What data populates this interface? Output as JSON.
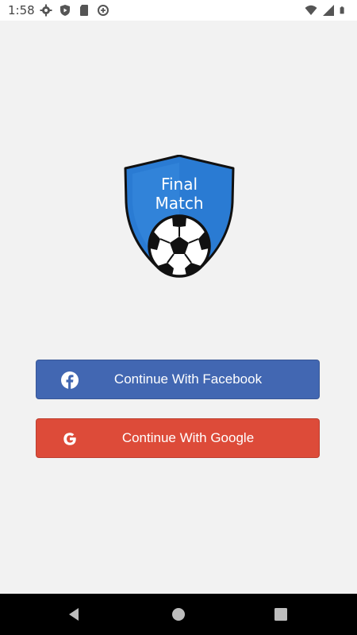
{
  "status_bar": {
    "time": "1:58"
  },
  "logo": {
    "line1": "Final",
    "line2": "Match"
  },
  "buttons": {
    "facebook": {
      "label": "Continue With Facebook",
      "color": "#4267b2"
    },
    "google": {
      "label": "Continue With Google",
      "color": "#dd4b39"
    }
  },
  "icons": {
    "status_left": [
      "gear-icon",
      "play-protect-icon",
      "sd-card-icon",
      "data-saver-icon"
    ],
    "status_right": [
      "wifi-icon",
      "cellular-icon",
      "battery-icon"
    ],
    "nav": [
      "back-icon",
      "home-icon",
      "recents-icon"
    ]
  }
}
